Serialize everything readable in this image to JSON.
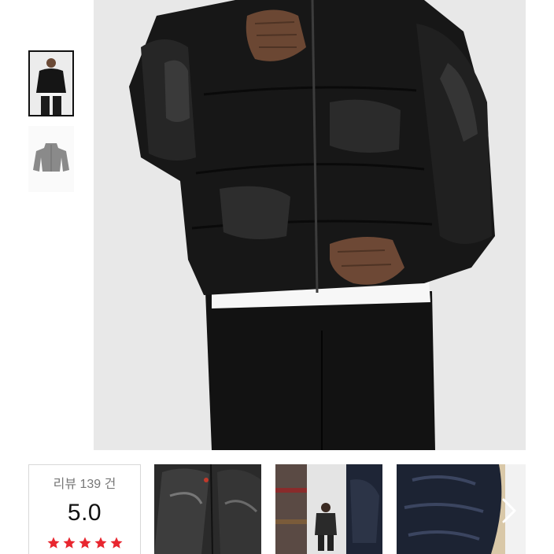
{
  "gallery": {
    "thumbnails": [
      {
        "name": "thumbnail-model-front",
        "selected": true
      },
      {
        "name": "thumbnail-jacket-flat",
        "selected": false
      }
    ]
  },
  "reviews": {
    "count_label": "리뷰 139 건",
    "score": "5.0",
    "star_rating": 5,
    "star_color": "#e8262f"
  },
  "icons": {
    "next": "chevron-right-icon",
    "star": "star-icon"
  }
}
